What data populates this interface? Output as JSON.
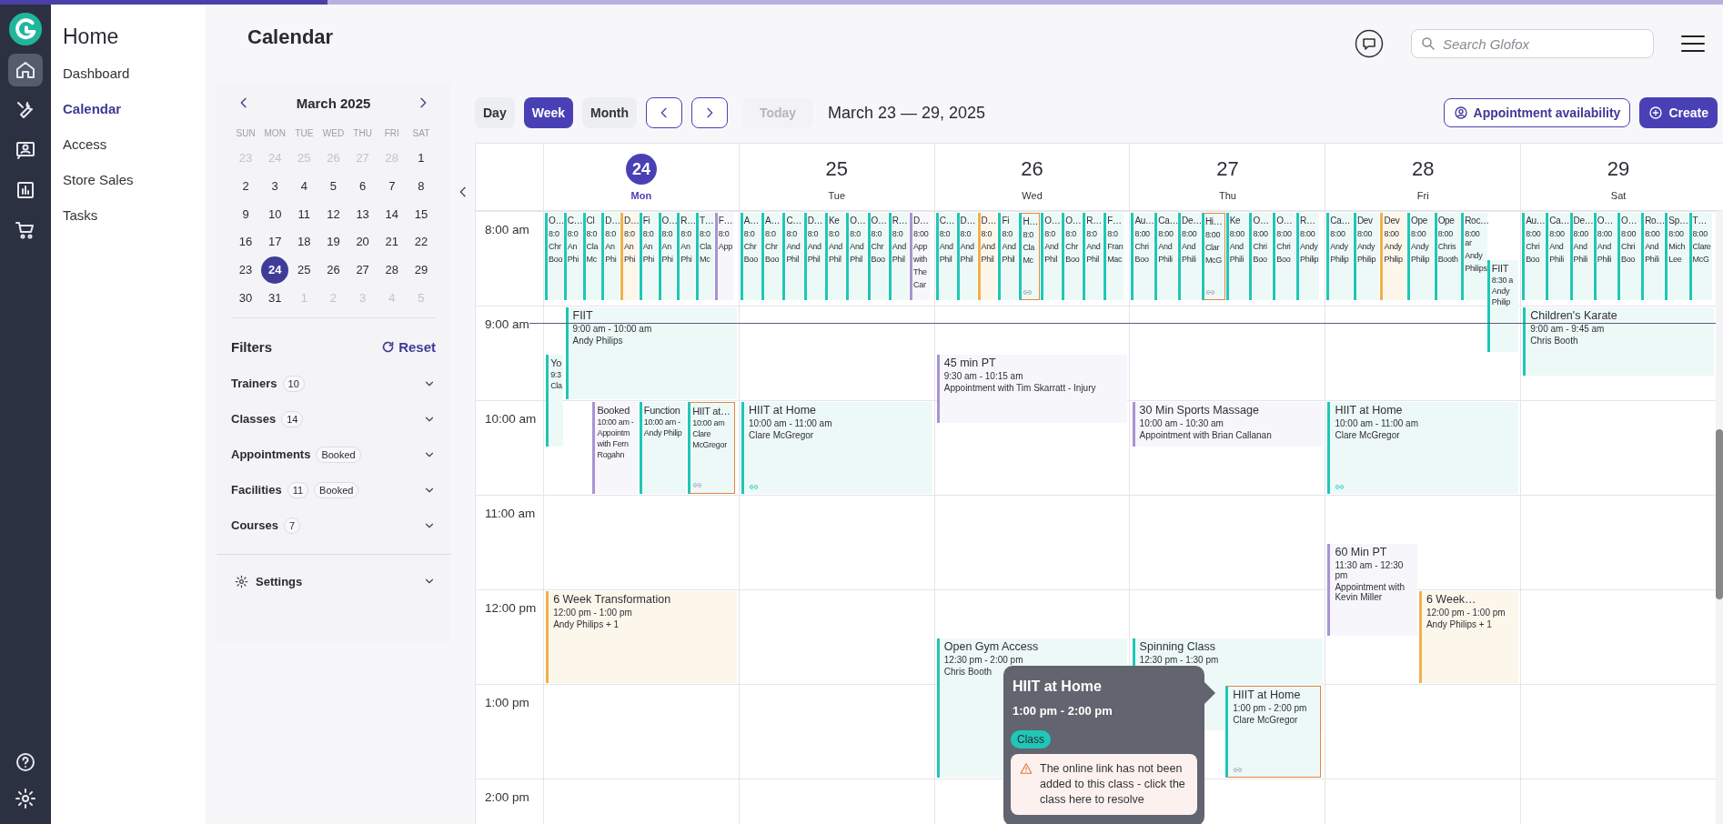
{
  "rail": {
    "items": [
      {
        "selected": true
      },
      {
        "selected": false
      },
      {
        "selected": false
      },
      {
        "selected": false
      },
      {
        "selected": false
      }
    ]
  },
  "nav": {
    "title": "Home",
    "items": [
      {
        "label": "Dashboard",
        "selected": false
      },
      {
        "label": "Calendar",
        "selected": true
      },
      {
        "label": "Access",
        "selected": false
      },
      {
        "label": "Store Sales",
        "selected": false
      },
      {
        "label": "Tasks",
        "selected": false
      }
    ]
  },
  "header": {
    "title": "Calendar",
    "search": {
      "placeholder": "Search Glofox"
    }
  },
  "mini_calendar": {
    "month": "March 2025",
    "weekdays": [
      "SUN",
      "MON",
      "TUE",
      "WED",
      "THU",
      "FRI",
      "SAT"
    ],
    "weeks": [
      [
        {
          "day": "23",
          "muted": true,
          "selected": false
        },
        {
          "day": "24",
          "muted": true,
          "selected": false
        },
        {
          "day": "25",
          "muted": true,
          "selected": false
        },
        {
          "day": "26",
          "muted": true,
          "selected": false
        },
        {
          "day": "27",
          "muted": true,
          "selected": false
        },
        {
          "day": "28",
          "muted": true,
          "selected": false
        },
        {
          "day": "1",
          "muted": false,
          "selected": false
        }
      ],
      [
        {
          "day": "2",
          "muted": false,
          "selected": false
        },
        {
          "day": "3",
          "muted": false,
          "selected": false
        },
        {
          "day": "4",
          "muted": false,
          "selected": false
        },
        {
          "day": "5",
          "muted": false,
          "selected": false
        },
        {
          "day": "6",
          "muted": false,
          "selected": false
        },
        {
          "day": "7",
          "muted": false,
          "selected": false
        },
        {
          "day": "8",
          "muted": false,
          "selected": false
        }
      ],
      [
        {
          "day": "9",
          "muted": false,
          "selected": false
        },
        {
          "day": "10",
          "muted": false,
          "selected": false
        },
        {
          "day": "11",
          "muted": false,
          "selected": false
        },
        {
          "day": "12",
          "muted": false,
          "selected": false
        },
        {
          "day": "13",
          "muted": false,
          "selected": false
        },
        {
          "day": "14",
          "muted": false,
          "selected": false
        },
        {
          "day": "15",
          "muted": false,
          "selected": false
        }
      ],
      [
        {
          "day": "16",
          "muted": false,
          "selected": false
        },
        {
          "day": "17",
          "muted": false,
          "selected": false
        },
        {
          "day": "18",
          "muted": false,
          "selected": false
        },
        {
          "day": "19",
          "muted": false,
          "selected": false
        },
        {
          "day": "20",
          "muted": false,
          "selected": false
        },
        {
          "day": "21",
          "muted": false,
          "selected": false
        },
        {
          "day": "22",
          "muted": false,
          "selected": false
        }
      ],
      [
        {
          "day": "23",
          "muted": false,
          "selected": false
        },
        {
          "day": "24",
          "muted": false,
          "selected": true
        },
        {
          "day": "25",
          "muted": false,
          "selected": false
        },
        {
          "day": "26",
          "muted": false,
          "selected": false
        },
        {
          "day": "27",
          "muted": false,
          "selected": false
        },
        {
          "day": "28",
          "muted": false,
          "selected": false
        },
        {
          "day": "29",
          "muted": false,
          "selected": false
        }
      ],
      [
        {
          "day": "30",
          "muted": false,
          "selected": false
        },
        {
          "day": "31",
          "muted": false,
          "selected": false
        },
        {
          "day": "1",
          "muted": true,
          "selected": false
        },
        {
          "day": "2",
          "muted": true,
          "selected": false
        },
        {
          "day": "3",
          "muted": true,
          "selected": false
        },
        {
          "day": "4",
          "muted": true,
          "selected": false
        },
        {
          "day": "5",
          "muted": true,
          "selected": false
        }
      ]
    ]
  },
  "filters": {
    "title": "Filters",
    "reset": "Reset",
    "items": [
      {
        "label": "Trainers",
        "count": "10"
      },
      {
        "label": "Classes",
        "count": "14"
      },
      {
        "label": "Appointments",
        "tag": "Booked"
      },
      {
        "label": "Facilities",
        "count": "11",
        "tag": "Booked"
      },
      {
        "label": "Courses",
        "count": "7"
      }
    ],
    "settings": "Settings"
  },
  "toolbar": {
    "views": [
      {
        "label": "Day",
        "selected": false
      },
      {
        "label": "Week",
        "selected": true
      },
      {
        "label": "Month",
        "selected": false
      }
    ],
    "today": {
      "label": "Today",
      "disabled": true
    },
    "range": "March 23 — 29, 2025",
    "availability": "Appointment availability",
    "create": "Create"
  },
  "calendar": {
    "times": [
      "8:00 am",
      "9:00 am",
      "10:00 am",
      "11:00 am",
      "12:00 pm",
      "1:00 pm",
      "2:00 pm"
    ],
    "days": [
      {
        "date": "24",
        "weekday": "Mon",
        "selected": true,
        "early_events": [
          {
            "kind": "class",
            "title": "O…",
            "time": "8:0",
            "lines": [
              "Chr",
              "Boo"
            ]
          },
          {
            "kind": "class",
            "title": "C…",
            "time": "8:0",
            "lines": [
              "An",
              "Phi"
            ]
          },
          {
            "kind": "class",
            "title": "Cl",
            "time": "8:0",
            "lines": [
              "Cla",
              "Mc"
            ]
          },
          {
            "kind": "class",
            "title": "D…",
            "time": "8:0",
            "lines": [
              "An",
              "Phi"
            ]
          },
          {
            "kind": "course",
            "title": "D…",
            "time": "8:0",
            "lines": [
              "An",
              "Phi"
            ]
          },
          {
            "kind": "class",
            "title": "Fi",
            "time": "8:0",
            "lines": [
              "An",
              "Phi"
            ]
          },
          {
            "kind": "class",
            "title": "O…",
            "time": "8:0",
            "lines": [
              "An",
              "Phi"
            ]
          },
          {
            "kind": "class",
            "title": "R…",
            "time": "8:0",
            "lines": [
              "An",
              "Phi"
            ]
          },
          {
            "kind": "class",
            "title": "T…",
            "time": "8:0",
            "lines": [
              "Cla",
              "Mc"
            ]
          },
          {
            "kind": "appointment",
            "title": "F…",
            "time": "8:0",
            "lines": [
              "App"
            ]
          }
        ],
        "events": [
          {
            "kind": "class",
            "title": "FIIT",
            "time": "9:00 am - 10:00 am",
            "lines": [
              "Andy Philips"
            ]
          },
          {
            "kind": "class",
            "title": "Yo",
            "time": "9:3",
            "lines": [
              "Cla"
            ]
          },
          {
            "kind": "appointment",
            "title": "Booked",
            "time": "10:00 am -",
            "lines": [
              "Appointm",
              "with Fern",
              "Rogahn"
            ]
          },
          {
            "kind": "class",
            "title": "Function",
            "time": "10:00 am -",
            "lines": [
              "Andy Philip"
            ]
          },
          {
            "kind": "flagged",
            "title": "HIIT at…",
            "time": "10:00 am",
            "lines": [
              "Clare",
              "McGregor"
            ]
          },
          {
            "kind": "course",
            "title": "6 Week Transformation",
            "time": "12:00 pm - 1:00 pm",
            "lines": [
              "Andy Philips + 1"
            ]
          }
        ]
      },
      {
        "date": "25",
        "weekday": "Tue",
        "selected": false,
        "early_events": [
          {
            "kind": "class",
            "title": "A…",
            "time": "8:0",
            "lines": [
              "Chr",
              "Boo"
            ]
          },
          {
            "kind": "class",
            "title": "A…",
            "time": "8:0",
            "lines": [
              "Chr",
              "Boo"
            ]
          },
          {
            "kind": "class",
            "title": "C…",
            "time": "8:0",
            "lines": [
              "And",
              "Phil"
            ]
          },
          {
            "kind": "class",
            "title": "D…",
            "time": "8:0",
            "lines": [
              "And",
              "Phil"
            ]
          },
          {
            "kind": "class",
            "title": "Ke",
            "time": "8:0",
            "lines": [
              "And",
              "Phil"
            ]
          },
          {
            "kind": "class",
            "title": "O…",
            "time": "8:0",
            "lines": [
              "And",
              "Phil"
            ]
          },
          {
            "kind": "class",
            "title": "O…",
            "time": "8:0",
            "lines": [
              "Chr",
              "Boo"
            ]
          },
          {
            "kind": "class",
            "title": "R…",
            "time": "8:0",
            "lines": [
              "And",
              "Phil"
            ]
          },
          {
            "kind": "appointment",
            "title": "D…",
            "time": "8:00",
            "lines": [
              "App",
              "with",
              "The",
              "Car"
            ]
          }
        ],
        "events": [
          {
            "kind": "online",
            "title": "HIIT at Home",
            "time": "10:00 am - 11:00 am",
            "lines": [
              "Clare McGregor"
            ]
          }
        ]
      },
      {
        "date": "26",
        "weekday": "Wed",
        "selected": false,
        "early_events": [
          {
            "kind": "class",
            "title": "C…",
            "time": "8:0",
            "lines": [
              "And",
              "Phil"
            ]
          },
          {
            "kind": "class",
            "title": "D…",
            "time": "8:0",
            "lines": [
              "And",
              "Phil"
            ]
          },
          {
            "kind": "course",
            "title": "D…",
            "time": "8:0",
            "lines": [
              "And",
              "Phil"
            ]
          },
          {
            "kind": "class",
            "title": "Fi",
            "time": "8:0",
            "lines": [
              "And",
              "Phil"
            ]
          },
          {
            "kind": "flagged",
            "title": "H…",
            "time": "8:0",
            "lines": [
              "Cla",
              "Mc"
            ]
          },
          {
            "kind": "class",
            "title": "O…",
            "time": "8:0",
            "lines": [
              "And",
              "Phil"
            ]
          },
          {
            "kind": "class",
            "title": "O…",
            "time": "8:0",
            "lines": [
              "Chr",
              "Boo"
            ]
          },
          {
            "kind": "class",
            "title": "R…",
            "time": "8:0",
            "lines": [
              "And",
              "Phil"
            ]
          },
          {
            "kind": "class",
            "title": "F…",
            "time": "8:0",
            "lines": [
              "Fran",
              "Mac"
            ]
          }
        ],
        "events": [
          {
            "kind": "appointment",
            "title": "45 min PT",
            "time": "9:30 am - 10:15 am",
            "lines": [
              "Appointment with Tim Skarratt - Injury"
            ]
          },
          {
            "kind": "class",
            "title": "Open Gym Access",
            "time": "12:30 pm - 2:00 pm",
            "lines": [
              "Chris Booth"
            ]
          }
        ]
      },
      {
        "date": "27",
        "weekday": "Thu",
        "selected": false,
        "early_events": [
          {
            "kind": "class",
            "title": "Au…",
            "time": "8:00",
            "lines": [
              "Chri",
              "Boo"
            ]
          },
          {
            "kind": "class",
            "title": "Ca…",
            "time": "8:00",
            "lines": [
              "And",
              "Phili"
            ]
          },
          {
            "kind": "class",
            "title": "De…",
            "time": "8:00",
            "lines": [
              "And",
              "Phili"
            ]
          },
          {
            "kind": "flagged",
            "title": "Hi…",
            "time": "8:00",
            "lines": [
              "Clar",
              "McG"
            ]
          },
          {
            "kind": "class",
            "title": "Ke",
            "time": "8:00",
            "lines": [
              "And",
              "Phili"
            ]
          },
          {
            "kind": "class",
            "title": "O…",
            "time": "8:00",
            "lines": [
              "Chri",
              "Boo"
            ]
          },
          {
            "kind": "class",
            "title": "O…",
            "time": "8:00",
            "lines": [
              "Chri",
              "Boo"
            ]
          },
          {
            "kind": "class",
            "title": "R…",
            "time": "8:00",
            "lines": [
              "Andy",
              "Philip"
            ]
          }
        ],
        "events": [
          {
            "kind": "appointment",
            "title": "30 Min Sports Massage",
            "time": "10:00 am - 10:30 am",
            "lines": [
              "Appointment with Brian Callanan"
            ]
          },
          {
            "kind": "class",
            "title": "Spinning Class",
            "time": "12:30 pm - 1:30 pm"
          },
          {
            "kind": "flagged",
            "title": "HIIT at Home",
            "time": "1:00 pm - 2:00 pm",
            "lines": [
              "Clare McGregor"
            ]
          }
        ]
      },
      {
        "date": "28",
        "weekday": "Fri",
        "selected": false,
        "early_events": [
          {
            "kind": "class",
            "title": "Ca…",
            "time": "8:00",
            "lines": [
              "Andy",
              "Philip"
            ]
          },
          {
            "kind": "class",
            "title": "Dev",
            "time": "8:00",
            "lines": [
              "Andy",
              "Philip"
            ]
          },
          {
            "kind": "course",
            "title": "Dev",
            "time": "8:00",
            "lines": [
              "Andy",
              "Philip"
            ]
          },
          {
            "kind": "class",
            "title": "Ope",
            "time": "8:00",
            "lines": [
              "Andy",
              "Philip"
            ]
          },
          {
            "kind": "class",
            "title": "Ope",
            "time": "8:00",
            "lines": [
              "Chris",
              "Booth"
            ]
          },
          {
            "kind": "class",
            "title": "Roc…",
            "time": "8:00 ar",
            "lines": [
              "Andy",
              "Philips"
            ]
          }
        ],
        "events": [
          {
            "kind": "class",
            "title": "FIIT",
            "time": "8:30 a",
            "lines": [
              "Andy",
              "Philip"
            ]
          },
          {
            "kind": "online",
            "title": "HIIT at Home",
            "time": "10:00 am - 11:00 am",
            "lines": [
              "Clare McGregor"
            ]
          },
          {
            "kind": "appointment",
            "title": "60 Min PT",
            "time": "11:30 am - 12:30 pm",
            "lines": [
              "Appointment with Kevin Miller"
            ]
          },
          {
            "kind": "course",
            "title": "6 Week…",
            "time": "12:00 pm - 1:00 pm",
            "lines": [
              "Andy Philips + 1"
            ]
          }
        ]
      },
      {
        "date": "29",
        "weekday": "Sat",
        "selected": false,
        "early_events": [
          {
            "kind": "class",
            "title": "Au…",
            "time": "8:00",
            "lines": [
              "Chri",
              "Boo"
            ]
          },
          {
            "kind": "class",
            "title": "Ca…",
            "time": "8:00",
            "lines": [
              "And",
              "Phili"
            ]
          },
          {
            "kind": "class",
            "title": "De…",
            "time": "8:00",
            "lines": [
              "And",
              "Phili"
            ]
          },
          {
            "kind": "class",
            "title": "O…",
            "time": "8:00",
            "lines": [
              "And",
              "Phili"
            ]
          },
          {
            "kind": "class",
            "title": "O…",
            "time": "8:00",
            "lines": [
              "Chri",
              "Boo"
            ]
          },
          {
            "kind": "class",
            "title": "Ro…",
            "time": "8:00",
            "lines": [
              "And",
              "Phili"
            ]
          },
          {
            "kind": "class",
            "title": "Sp…",
            "time": "8:00",
            "lines": [
              "Mich",
              "Lee"
            ]
          },
          {
            "kind": "class",
            "title": "T…",
            "time": "8:00",
            "lines": [
              "Clare",
              "McG"
            ]
          }
        ],
        "events": [
          {
            "kind": "class",
            "title": "Children's Karate",
            "time": "9:00 am - 9:45 am",
            "lines": [
              "Chris Booth"
            ]
          }
        ]
      }
    ]
  },
  "tooltip": {
    "title": "HIIT at Home",
    "time": "1:00 pm - 2:00 pm",
    "tag": "Class",
    "warning": "The online link has not been added to this class - click the class here to resolve"
  }
}
